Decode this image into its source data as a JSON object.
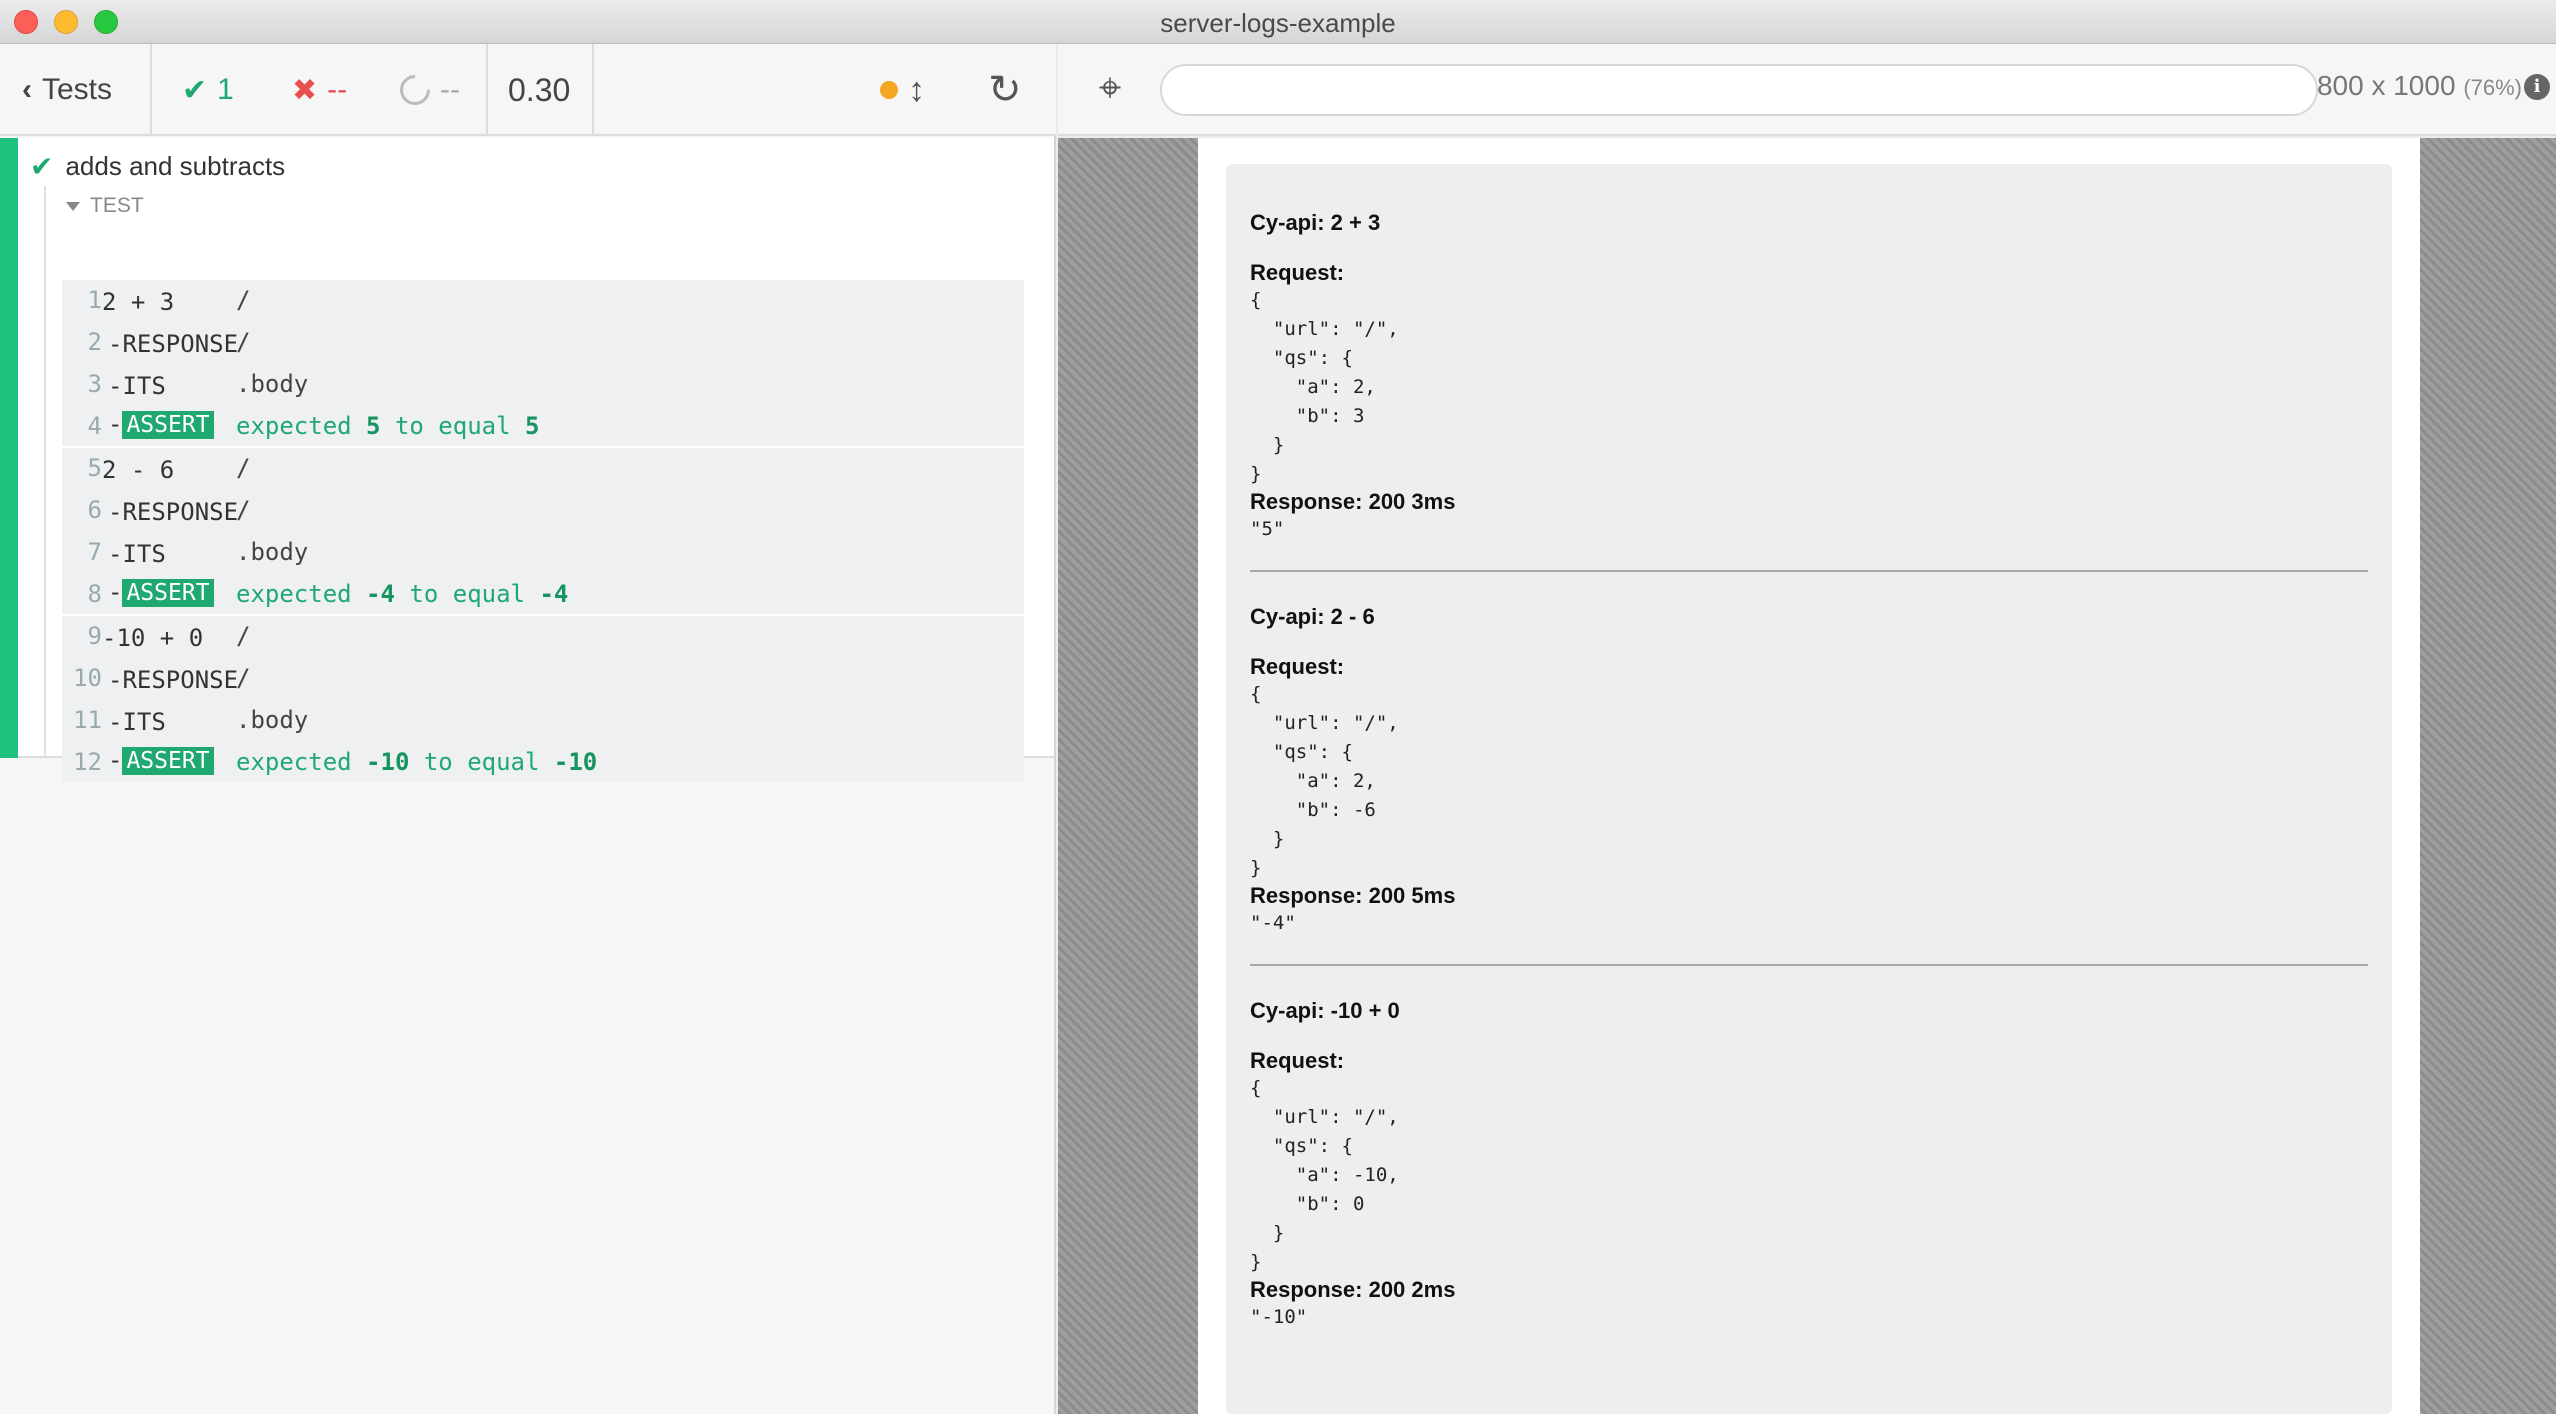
{
  "window": {
    "title": "server-logs-example"
  },
  "reporter": {
    "tests_label": "Tests",
    "passed": "1",
    "failed": "--",
    "pending": "--",
    "duration": "0.30",
    "suite": {
      "title": "adds and subtracts",
      "section_label": "TEST",
      "groups": [
        {
          "rows": [
            {
              "num": "1",
              "name": "2 + 3",
              "msg": "/",
              "type": "cmd"
            },
            {
              "num": "2",
              "name": "RESPONSE",
              "msg": "/",
              "type": "child"
            },
            {
              "num": "3",
              "name": "ITS",
              "msg": ".body",
              "type": "child"
            },
            {
              "num": "4",
              "name": "ASSERT",
              "msg_pre": "expected ",
              "msg_a": "5",
              "msg_mid": " to equal ",
              "msg_b": "5",
              "type": "assert"
            }
          ]
        },
        {
          "rows": [
            {
              "num": "5",
              "name": "2 - 6",
              "msg": "/",
              "type": "cmd"
            },
            {
              "num": "6",
              "name": "RESPONSE",
              "msg": "/",
              "type": "child"
            },
            {
              "num": "7",
              "name": "ITS",
              "msg": ".body",
              "type": "child"
            },
            {
              "num": "8",
              "name": "ASSERT",
              "msg_pre": "expected ",
              "msg_a": "-4",
              "msg_mid": " to equal ",
              "msg_b": "-4",
              "type": "assert"
            }
          ]
        },
        {
          "rows": [
            {
              "num": "9",
              "name": "-10 + 0",
              "msg": "/",
              "type": "cmd"
            },
            {
              "num": "10",
              "name": "RESPONSE",
              "msg": "/",
              "type": "child"
            },
            {
              "num": "11",
              "name": "ITS",
              "msg": ".body",
              "type": "child"
            },
            {
              "num": "12",
              "name": "ASSERT",
              "msg_pre": "expected ",
              "msg_a": "-10",
              "msg_mid": " to equal ",
              "msg_b": "-10",
              "type": "assert"
            }
          ]
        }
      ]
    }
  },
  "aut": {
    "url_value": "",
    "viewport": "800 x 1000",
    "scale": "(76%)",
    "logs": [
      {
        "title": "Cy-api: 2 + 3",
        "request_label": "Request:",
        "request_json": "{\n  \"url\": \"/\",\n  \"qs\": {\n    \"a\": 2,\n    \"b\": 3\n  }\n}",
        "response_label": "Response: 200 3ms",
        "response_body": "\"5\""
      },
      {
        "title": "Cy-api: 2 - 6",
        "request_label": "Request:",
        "request_json": "{\n  \"url\": \"/\",\n  \"qs\": {\n    \"a\": 2,\n    \"b\": -6\n  }\n}",
        "response_label": "Response: 200 5ms",
        "response_body": "\"-4\""
      },
      {
        "title": "Cy-api: -10 + 0",
        "request_label": "Request:",
        "request_json": "{\n  \"url\": \"/\",\n  \"qs\": {\n    \"a\": -10,\n    \"b\": 0\n  }\n}",
        "response_label": "Response: 200 2ms",
        "response_body": "\"-10\""
      }
    ]
  },
  "colors": {
    "pass": "#1fa971",
    "fail": "#e94f4f",
    "accent_bar": "#1fc17d",
    "running_dot": "#f5a623"
  }
}
